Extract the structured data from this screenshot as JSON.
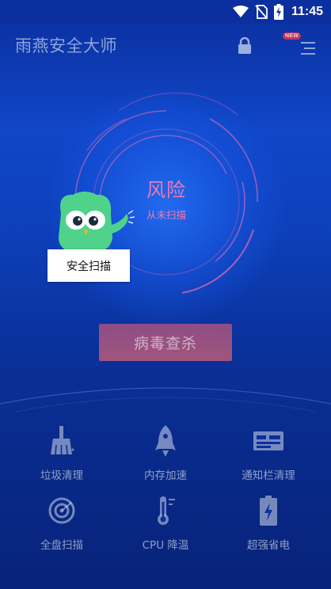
{
  "status_bar": {
    "time": "11:45",
    "icons": [
      "wifi-icon",
      "no-sim-icon",
      "battery-charging-icon"
    ]
  },
  "app_bar": {
    "title": "雨燕安全大师",
    "lock_icon": "lock-icon",
    "menu_icon": "menu-icon",
    "new_badge": "NEW"
  },
  "scan_status": {
    "title": "风险",
    "subtitle": "从未扫描"
  },
  "mascot": {
    "tooltip": "安全扫描"
  },
  "main_button": {
    "label": "病毒查杀"
  },
  "tools": [
    {
      "label": "垃圾清理",
      "icon": "broom-icon"
    },
    {
      "label": "内存加速",
      "icon": "rocket-icon"
    },
    {
      "label": "通知栏清理",
      "icon": "notification-bar-icon"
    },
    {
      "label": "全盘扫描",
      "icon": "target-scan-icon"
    },
    {
      "label": "CPU 降温",
      "icon": "thermometer-icon"
    },
    {
      "label": "超强省电",
      "icon": "battery-bolt-icon"
    }
  ],
  "colors": {
    "background": "#0d3fb9",
    "accent_pink": "#f07ab0",
    "button": "#9a5281",
    "mascot_green": "#4fd38a"
  }
}
